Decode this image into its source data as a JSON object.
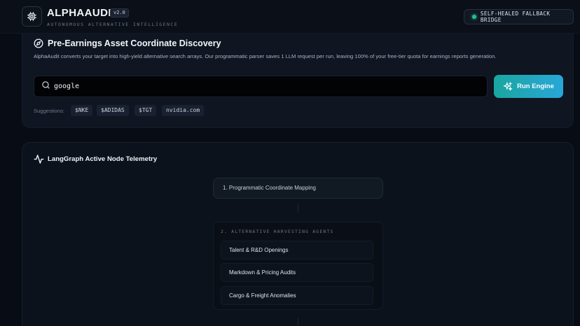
{
  "header": {
    "title": "ALPHAAUDIT",
    "version": "v2.0",
    "subtitle": "AUTONOMOUS ALTERNATIVE INTELLIGENCE",
    "status": "SELF-HEALED FALLBACK BRIDGE",
    "status_color": "#22c08a"
  },
  "discovery": {
    "title": "Pre-Earnings Asset Coordinate Discovery",
    "description": "AlphaAudit converts your target into high-yield alternative search arrays. Our programmatic parser saves 1 LLM request per run, leaving 100% of your free-tier quota for earnings reports generation.",
    "search_value": "google",
    "run_label": "Run Engine",
    "suggestions_label": "Suggestions:",
    "suggestions": [
      "$NKE",
      "$ADIDAS",
      "$TGT",
      "nvidia.com"
    ]
  },
  "telemetry": {
    "title": "LangGraph Active Node Telemetry",
    "node1": "1. Programmatic Coordinate Mapping",
    "group_title": "2. ALTERNATIVE HARVESTING AGENTS",
    "agents": [
      "Talent & R&D Openings",
      "Markdown & Pricing Audits",
      "Cargo & Freight Anomalies"
    ]
  },
  "icons": {
    "logo": "chip-icon",
    "discovery": "compass-icon",
    "search": "search-icon",
    "run": "sparkles-icon",
    "telemetry": "activity-icon"
  },
  "colors": {
    "accent_start": "#1aa6a0",
    "accent_end": "#28a7d8",
    "background": "#080c14"
  }
}
